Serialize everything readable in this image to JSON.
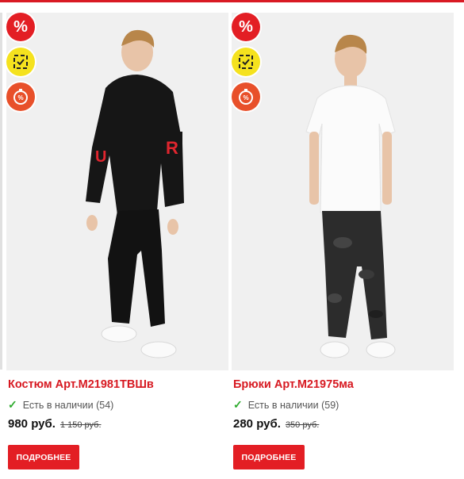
{
  "products": [
    {
      "title": "Костюм Арт.М21981ТВШв",
      "stock": "Есть в наличии (54)",
      "price": "980 руб.",
      "old_price": "1 150 руб.",
      "button": "ПОДРОБНЕЕ",
      "badge_percent": "%"
    },
    {
      "title": "Брюки Арт.М21975ма",
      "stock": "Есть в наличии (59)",
      "price": "280 руб.",
      "old_price": "350 руб.",
      "button": "ПОДРОБНЕЕ",
      "badge_percent": "%"
    }
  ],
  "colors": {
    "accent": "#e31e24",
    "in_stock": "#2eab2e"
  }
}
